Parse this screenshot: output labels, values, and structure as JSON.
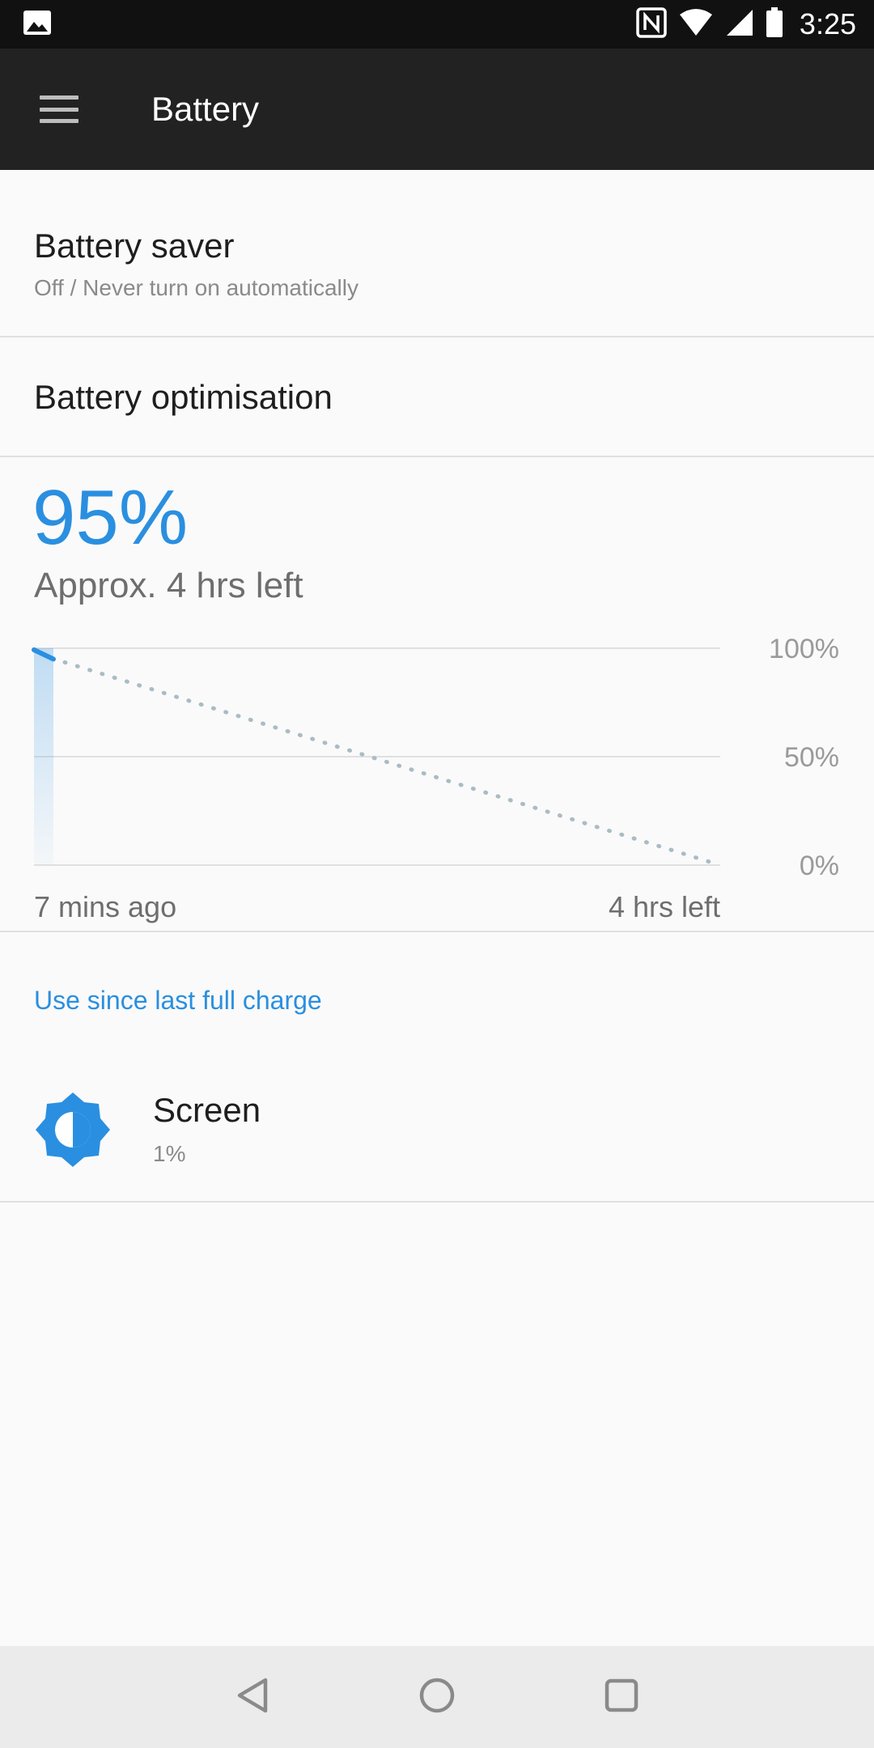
{
  "status_bar": {
    "time": "3:25",
    "icons": [
      "image-notification-icon",
      "nfc-icon",
      "wifi-icon",
      "cellular-signal-icon",
      "battery-icon"
    ]
  },
  "app_bar": {
    "title": "Battery",
    "menu_icon": "hamburger-menu-icon"
  },
  "battery_saver": {
    "title": "Battery saver",
    "subtitle": "Off / Never turn on automatically"
  },
  "battery_optimisation": {
    "title": "Battery optimisation"
  },
  "battery_status": {
    "percent": "95%",
    "remaining": "Approx. 4 hrs left"
  },
  "chart_data": {
    "type": "line",
    "y_tick_labels": [
      "100%",
      "50%",
      "0%"
    ],
    "ylim": [
      0,
      100
    ],
    "x_start_label": "7 mins ago",
    "x_end_label": "4 hrs left",
    "series": [
      {
        "values": [
          100,
          95
        ],
        "style": "solid"
      },
      {
        "values": [
          95,
          0
        ],
        "style": "dotted-projection"
      }
    ],
    "grid": true,
    "colors": {
      "actual": "#2a8fe0",
      "projection": "#a9bcc4",
      "grid": "#e0e0e0"
    }
  },
  "usage_section": {
    "header": "Use since last full charge",
    "items": [
      {
        "icon": "brightness-icon",
        "title": "Screen",
        "value": "1%"
      }
    ]
  },
  "nav_bar": {
    "icons": [
      "back-icon",
      "home-icon",
      "recents-icon"
    ]
  },
  "colors": {
    "accent": "#2a8fe0",
    "app_bar": "#222222",
    "status_bar": "#111111",
    "background": "#fafafa"
  }
}
